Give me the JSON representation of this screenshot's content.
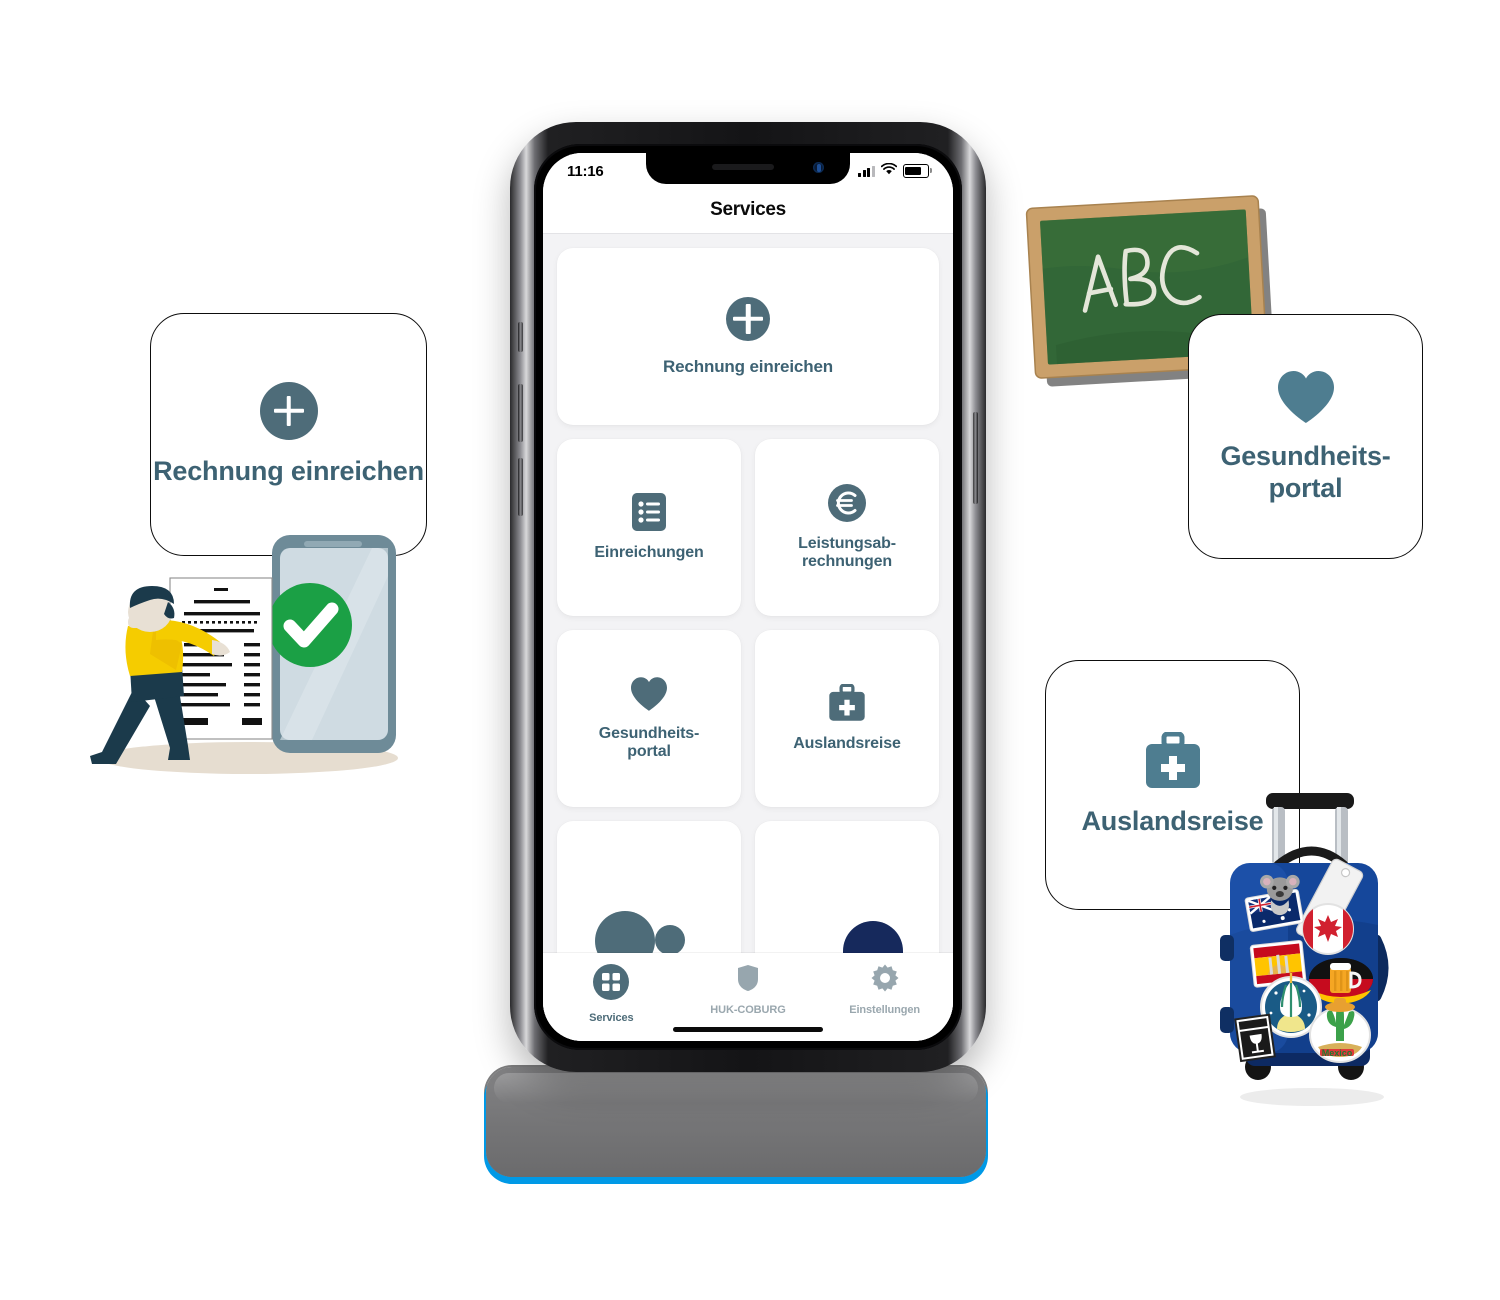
{
  "phone": {
    "status_bar": {
      "time": "11:16",
      "cellular_icon": "cellular-bars-icon",
      "wifi_icon": "wifi-icon",
      "battery_icon": "battery-icon"
    },
    "nav_title": "Services",
    "tiles": [
      {
        "id": "rechnung-einreichen",
        "label": "Rechnung einreichen",
        "icon": "plus-circle-icon",
        "wide": true
      },
      {
        "id": "einreichungen",
        "label": "Einreichungen",
        "icon": "list-document-icon",
        "wide": false
      },
      {
        "id": "leistungsabrechnungen",
        "label": "Leistungsab-\nrechnungen",
        "line1": "Leistungsab-",
        "line2": "rechnungen",
        "icon": "euro-circle-icon",
        "wide": false
      },
      {
        "id": "gesundheitsportal",
        "label": "Gesundheits-\nportal",
        "line1": "Gesundheits-",
        "line2": "portal",
        "icon": "heart-icon",
        "wide": false
      },
      {
        "id": "auslandsreise",
        "label": "Auslandsreise",
        "icon": "medical-briefcase-icon",
        "wide": false
      }
    ],
    "tab_bar": [
      {
        "id": "services",
        "label": "Services",
        "icon": "grid-squares-icon",
        "active": true
      },
      {
        "id": "huk-coburg",
        "label": "HUK-COBURG",
        "icon": "shield-icon",
        "active": false
      },
      {
        "id": "einstellungen",
        "label": "Einstellungen",
        "icon": "gear-icon",
        "active": false
      }
    ]
  },
  "floating_cards": [
    {
      "id": "rechnung-einreichen",
      "label": "Rechnung einreichen",
      "icon": "plus-circle-icon"
    },
    {
      "id": "gesundheitsportal",
      "line1": "Gesundheits-",
      "line2": "portal",
      "icon": "heart-icon"
    },
    {
      "id": "auslandsreise",
      "label": "Auslandsreise",
      "icon": "medical-briefcase-icon"
    }
  ],
  "illustrations": [
    {
      "id": "invoice-submission",
      "name": "person-pushing-invoice-into-phone-illustration",
      "chalk_text": ""
    },
    {
      "id": "chalkboard",
      "name": "green-chalkboard-illustration",
      "chalk_text": "ABC"
    },
    {
      "id": "suitcase",
      "name": "blue-travel-suitcase-with-stickers-illustration",
      "chalk_text": ""
    }
  ],
  "colors": {
    "accent_teal": "#3d6273",
    "icon_teal": "#4e6c79",
    "screen_background": "#f3f3f5",
    "tile_background": "#ffffff",
    "tab_inactive": "#9aa7ae",
    "phone_base_glow": "#0099e6",
    "illustration_yellow": "#f5cc00",
    "illustration_navy": "#1b3a4b",
    "illustration_green": "#1ba045",
    "chalkboard_green": "#2d6134",
    "chalkboard_frame": "#c59a63",
    "suitcase_blue": "#15479b"
  }
}
